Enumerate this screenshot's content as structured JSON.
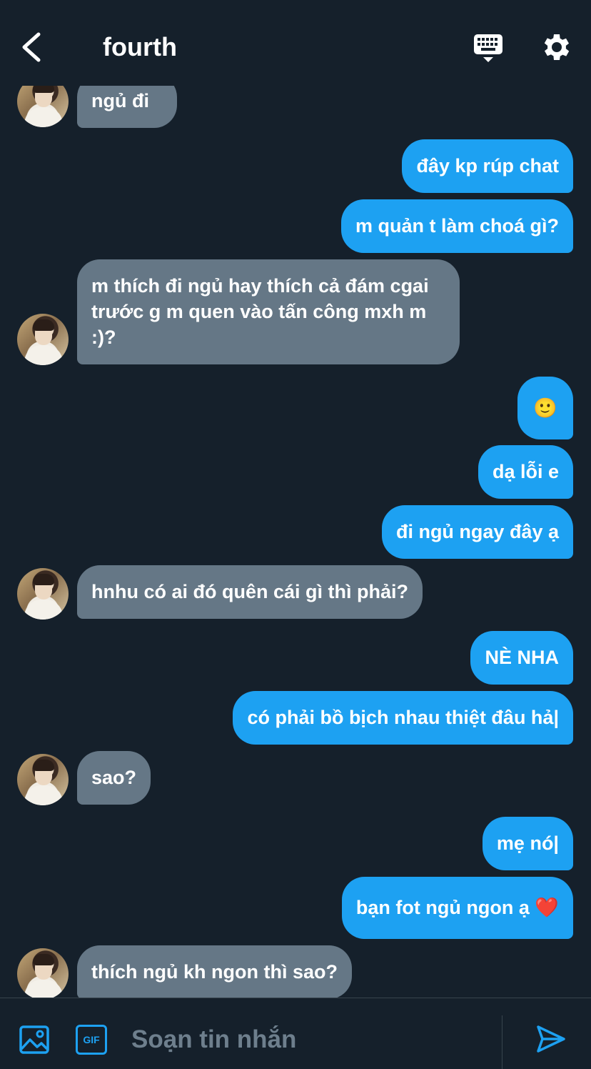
{
  "header": {
    "title": "fourth"
  },
  "messages": [
    {
      "dir": "in",
      "text": "ngủ đi"
    },
    {
      "dir": "out",
      "text": "đây kp rúp chat"
    },
    {
      "dir": "out",
      "text": "m quản t làm choá gì?"
    },
    {
      "dir": "in",
      "text": "m thích đi ngủ hay thích cả đám cgai trước g m quen vào tấn công mxh m :)?"
    },
    {
      "dir": "out",
      "text": "🙂"
    },
    {
      "dir": "out",
      "text": "dạ lỗi e"
    },
    {
      "dir": "out",
      "text": "đi ngủ ngay đây ạ"
    },
    {
      "dir": "in",
      "text": "hnhu có ai đó quên cái gì thì phải?"
    },
    {
      "dir": "out",
      "text": "NÈ NHA"
    },
    {
      "dir": "out",
      "text": "có phải bồ bịch nhau thiệt đâu hả|"
    },
    {
      "dir": "in",
      "text": "sao?"
    },
    {
      "dir": "out",
      "text": "mẹ nó|"
    },
    {
      "dir": "out",
      "text": "bạn fot ngủ ngon ạ ❤️"
    },
    {
      "dir": "in",
      "text": "thích ngủ kh ngon thì sao?"
    }
  ],
  "composer": {
    "placeholder": "Soạn tin nhắn",
    "gif_label": "GIF"
  },
  "colors": {
    "background": "#15202b",
    "incoming": "#657786",
    "outgoing": "#1da1f2",
    "accent": "#1da1f2"
  },
  "icons": {
    "back": "chevron-left-icon",
    "keyboard": "keyboard-icon",
    "settings": "gear-icon",
    "image": "image-icon",
    "send": "send-icon"
  }
}
